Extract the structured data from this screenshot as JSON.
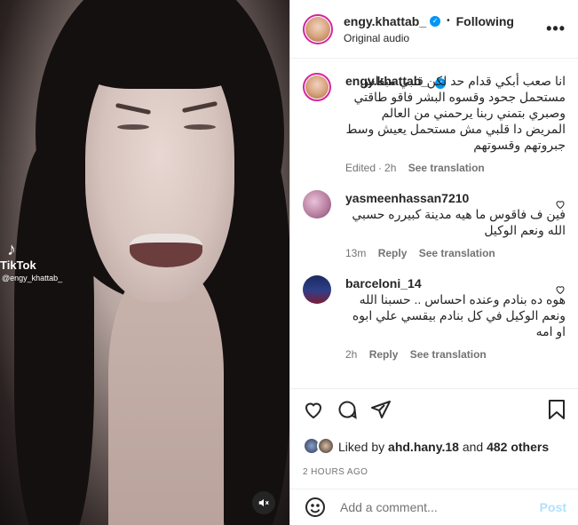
{
  "media": {
    "watermark_brand": "TikTok",
    "watermark_handle": "@engy_khattab_",
    "mute_icon": "speaker-muted-icon"
  },
  "header": {
    "username": "engy.khattab_",
    "separator": "•",
    "follow_state": "Following",
    "audio": "Original audio",
    "more_icon": "more-horizontal-icon"
  },
  "caption": {
    "username": "engy.khattab_",
    "text": "انا صعب أبكي قدام حد لكن قلبي مبقاش مستحمل جحود وقسوه البشر فاقو طاقتي وصبري بتمني ربنا يرحمني من العالم المريض دا قلبي مش مستحمل يعيش وسط جبروتهم وقسوتهم",
    "edited": "Edited",
    "time": "2h",
    "see_translation": "See translation"
  },
  "comments": [
    {
      "username": "yasmeenhassan7210",
      "text": "فين ف فاقوس ما هيه مدينة كبيرره حسبي الله ونعم الوكيل",
      "time": "13m",
      "reply": "Reply",
      "see_translation": "See translation"
    },
    {
      "username": "barceloni_14",
      "text": "هوه ده بنادم وعنده احساس .. حسبنا الله ونعم الوكيل في كل بنادم بيقسي علي ابوه او امه",
      "time": "2h",
      "reply": "Reply",
      "see_translation": "See translation"
    }
  ],
  "actions": {
    "icons": [
      "heart-icon",
      "comment-icon",
      "share-icon",
      "bookmark-icon"
    ]
  },
  "likes": {
    "prefix": "Liked by",
    "user": "ahd.hany.18",
    "connector": "and",
    "others": "482 others"
  },
  "timestamp": "2 HOURS AGO",
  "add_comment": {
    "placeholder": "Add a comment...",
    "post_label": "Post"
  },
  "colors": {
    "verified": "#0095f6",
    "secondary_text": "#737373",
    "post_disabled": "#b2dffc"
  }
}
